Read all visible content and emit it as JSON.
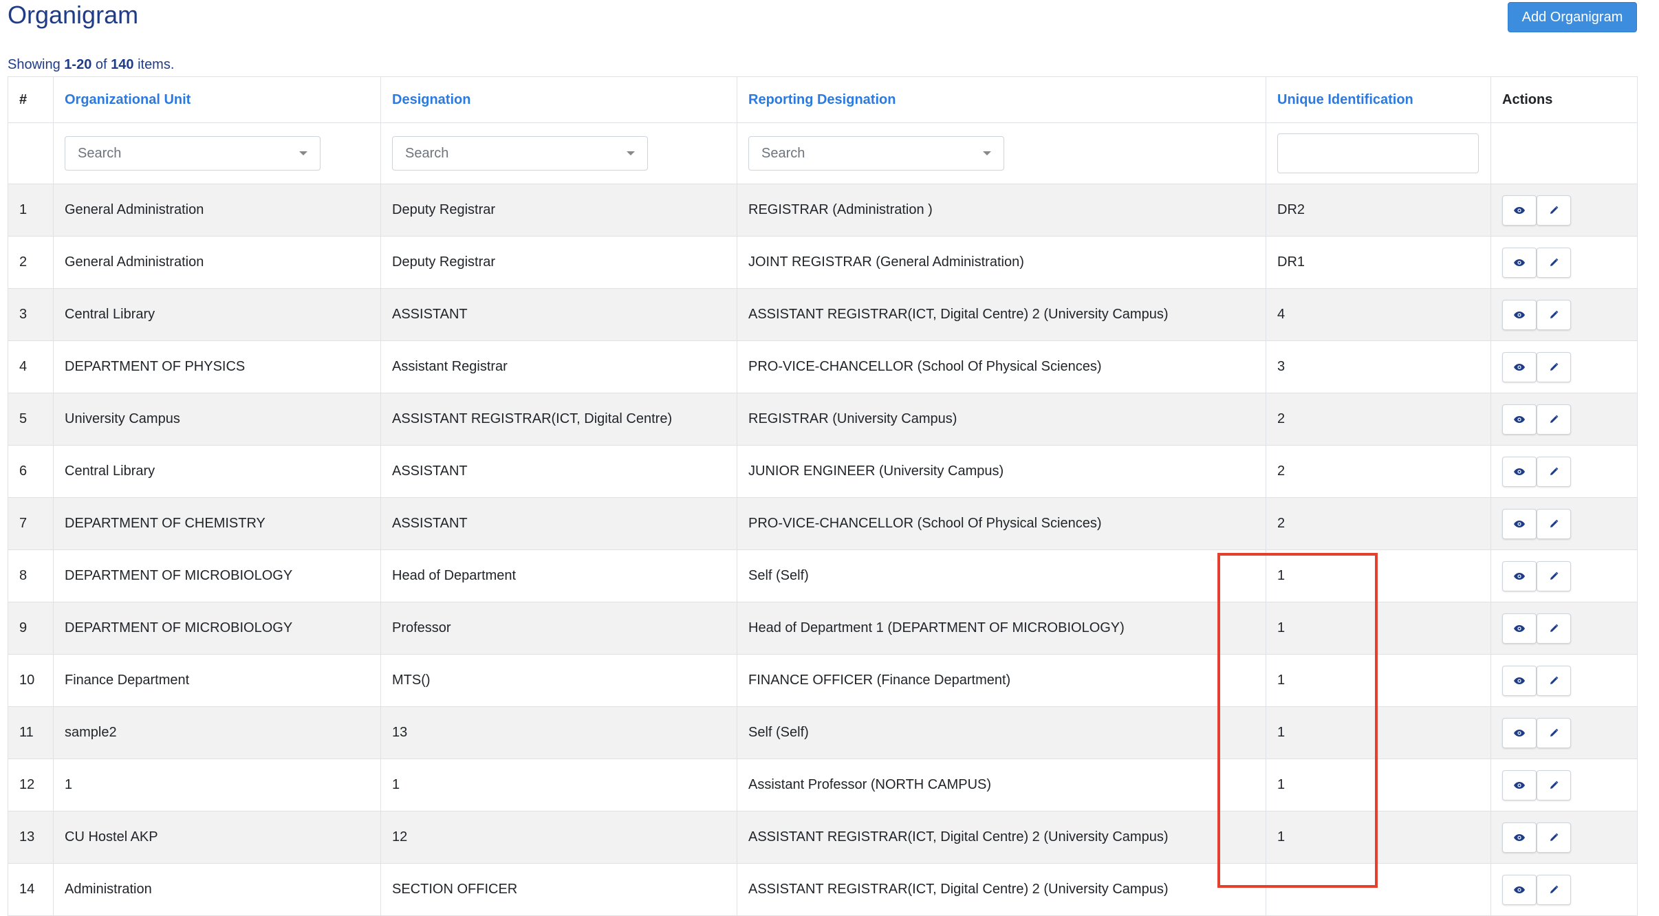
{
  "page": {
    "title": "Organigram",
    "add_button": "Add Organigram"
  },
  "summary": {
    "prefix": "Showing",
    "range": "1-20",
    "of": "of",
    "total": "140",
    "suffix": "items."
  },
  "table": {
    "columns": {
      "num": "#",
      "org_unit": "Organizational Unit",
      "designation": "Designation",
      "reporting": "Reporting Designation",
      "unique_id": "Unique Identification",
      "actions": "Actions"
    },
    "filters": {
      "org_unit_placeholder": "Search",
      "designation_placeholder": "Search",
      "reporting_placeholder": "Search",
      "unique_id_value": ""
    },
    "rows": [
      {
        "num": "1",
        "org_unit": "General Administration",
        "designation": "Deputy Registrar",
        "reporting": "REGISTRAR (Administration )",
        "unique_id": "DR2"
      },
      {
        "num": "2",
        "org_unit": "General Administration",
        "designation": "Deputy Registrar",
        "reporting": "JOINT REGISTRAR (General Administration)",
        "unique_id": "DR1"
      },
      {
        "num": "3",
        "org_unit": "Central Library",
        "designation": "ASSISTANT",
        "reporting": "ASSISTANT REGISTRAR(ICT, Digital Centre) 2 (University Campus)",
        "unique_id": "4"
      },
      {
        "num": "4",
        "org_unit": "DEPARTMENT OF PHYSICS",
        "designation": "Assistant Registrar",
        "reporting": "PRO-VICE-CHANCELLOR (School Of Physical Sciences)",
        "unique_id": "3"
      },
      {
        "num": "5",
        "org_unit": "University Campus",
        "designation": "ASSISTANT REGISTRAR(ICT, Digital Centre)",
        "reporting": "REGISTRAR (University Campus)",
        "unique_id": "2"
      },
      {
        "num": "6",
        "org_unit": "Central Library",
        "designation": "ASSISTANT",
        "reporting": "JUNIOR ENGINEER (University Campus)",
        "unique_id": "2"
      },
      {
        "num": "7",
        "org_unit": "DEPARTMENT OF CHEMISTRY",
        "designation": "ASSISTANT",
        "reporting": "PRO-VICE-CHANCELLOR (School Of Physical Sciences)",
        "unique_id": "2"
      },
      {
        "num": "8",
        "org_unit": "DEPARTMENT OF MICROBIOLOGY",
        "designation": "Head of Department",
        "reporting": "Self (Self)",
        "unique_id": "1"
      },
      {
        "num": "9",
        "org_unit": "DEPARTMENT OF MICROBIOLOGY",
        "designation": "Professor",
        "reporting": "Head of Department 1 (DEPARTMENT OF MICROBIOLOGY)",
        "unique_id": "1"
      },
      {
        "num": "10",
        "org_unit": "Finance Department",
        "designation": "MTS()",
        "reporting": "FINANCE OFFICER (Finance Department)",
        "unique_id": "1"
      },
      {
        "num": "11",
        "org_unit": "sample2",
        "designation": "13",
        "reporting": "Self (Self)",
        "unique_id": "1"
      },
      {
        "num": "12",
        "org_unit": "1",
        "designation": "1",
        "reporting": "Assistant Professor (NORTH CAMPUS)",
        "unique_id": "1"
      },
      {
        "num": "13",
        "org_unit": "CU Hostel AKP",
        "designation": "12",
        "reporting": "ASSISTANT REGISTRAR(ICT, Digital Centre) 2 (University Campus)",
        "unique_id": "1"
      },
      {
        "num": "14",
        "org_unit": "Administration",
        "designation": "SECTION OFFICER",
        "reporting": "ASSISTANT REGISTRAR(ICT, Digital Centre) 2 (University Campus)",
        "unique_id": ""
      }
    ],
    "row_actions": [
      "eye-icon",
      "pencil-icon"
    ]
  },
  "colors": {
    "title": "#1f3c88",
    "link": "#2a7ae2",
    "button": "#3c8dde",
    "highlight": "#e3402f",
    "stripe": "#f2f2f2"
  }
}
